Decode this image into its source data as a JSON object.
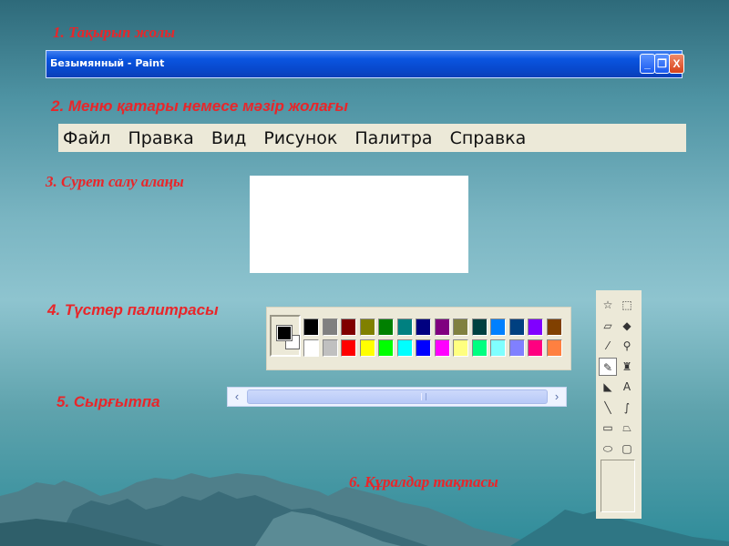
{
  "captions": {
    "title_bar": "1. Тақырып жолы",
    "menu_bar": "2. Меню қатары немесе мәзір жолағы",
    "canvas": "3. Сурет салу алаңы",
    "palette": "4. Түстер палитрасы",
    "scrollbar": "5. Сырғытпа",
    "toolbox": "6. Құралдар тақтасы"
  },
  "window": {
    "title": "Безымянный - Paint",
    "minimize_glyph": "_",
    "maximize_glyph": "❐",
    "close_glyph": "X"
  },
  "menu": [
    "Файл",
    "Правка",
    "Вид",
    "Рисунок",
    "Палитра",
    "Справка"
  ],
  "palette": {
    "foreground": "#000000",
    "background": "#ffffff",
    "row1": [
      "#000000",
      "#808080",
      "#800000",
      "#808000",
      "#008000",
      "#008080",
      "#000080",
      "#800080",
      "#808040",
      "#004040",
      "#0080ff",
      "#004080",
      "#8000ff",
      "#804000"
    ],
    "row2": [
      "#ffffff",
      "#c0c0c0",
      "#ff0000",
      "#ffff00",
      "#00ff00",
      "#00ffff",
      "#0000ff",
      "#ff00ff",
      "#ffff80",
      "#00ff80",
      "#80ffff",
      "#8080ff",
      "#ff0080",
      "#ff8040"
    ]
  },
  "scrollbar": {
    "left_arrow": "‹",
    "right_arrow": "›"
  },
  "tools": [
    {
      "name": "free-select-icon",
      "glyph": "☆"
    },
    {
      "name": "rect-select-icon",
      "glyph": "⬚"
    },
    {
      "name": "eraser-icon",
      "glyph": "▱"
    },
    {
      "name": "fill-icon",
      "glyph": "◆"
    },
    {
      "name": "color-picker-icon",
      "glyph": "⁄"
    },
    {
      "name": "magnifier-icon",
      "glyph": "⚲"
    },
    {
      "name": "pencil-icon",
      "glyph": "✎"
    },
    {
      "name": "brush-icon",
      "glyph": "♜"
    },
    {
      "name": "airbrush-icon",
      "glyph": "◣"
    },
    {
      "name": "text-icon",
      "glyph": "A"
    },
    {
      "name": "line-icon",
      "glyph": "╲"
    },
    {
      "name": "curve-icon",
      "glyph": "∫"
    },
    {
      "name": "rectangle-icon",
      "glyph": "▭"
    },
    {
      "name": "polygon-icon",
      "glyph": "⏢"
    },
    {
      "name": "ellipse-icon",
      "glyph": "⬭"
    },
    {
      "name": "rounded-rect-icon",
      "glyph": "▢"
    }
  ],
  "active_tool": "pencil-icon",
  "colors": {
    "caption_red": "#e8262a",
    "titlebar_blue": "#0a55e0",
    "panel_beige": "#ece9d8"
  }
}
